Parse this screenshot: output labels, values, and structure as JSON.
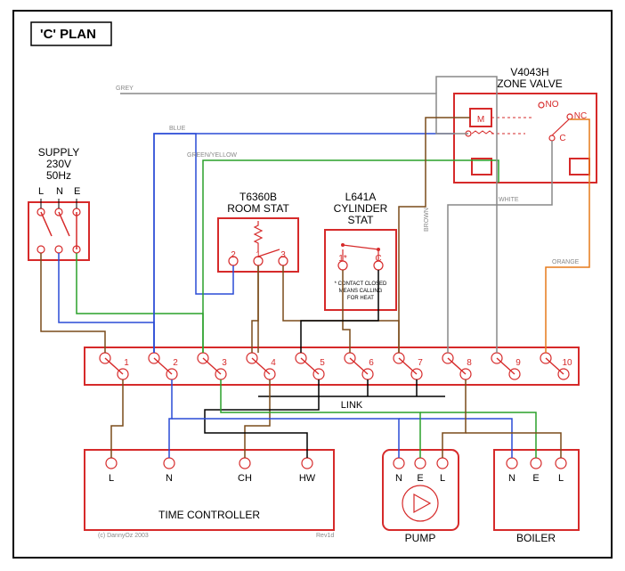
{
  "title": "'C' PLAN",
  "supply": {
    "label": "SUPPLY",
    "voltage": "230V",
    "hz": "50Hz",
    "terminals": [
      "L",
      "N",
      "E"
    ]
  },
  "room_stat": {
    "model": "T6360B",
    "label": "ROOM STAT",
    "terminals": [
      "2",
      "1",
      "3"
    ]
  },
  "cyl_stat": {
    "model": "L641A",
    "label": "CYLINDER",
    "label2": "STAT",
    "terminals": [
      "1*",
      "C"
    ],
    "note1": "* CONTACT CLOSED",
    "note2": "MEANS CALLING",
    "note3": "FOR HEAT"
  },
  "zone_valve": {
    "model": "V4043H",
    "label": "ZONE VALVE",
    "m": "M",
    "no": "NO",
    "nc": "NC",
    "c": "C"
  },
  "link_label": "LINK",
  "terminal_strip": [
    "1",
    "2",
    "3",
    "4",
    "5",
    "6",
    "7",
    "8",
    "9",
    "10"
  ],
  "time_controller": {
    "label": "TIME CONTROLLER",
    "terminals": [
      "L",
      "N",
      "CH",
      "HW"
    ]
  },
  "pump": {
    "label": "PUMP",
    "terminals": [
      "N",
      "E",
      "L"
    ]
  },
  "boiler": {
    "label": "BOILER",
    "terminals": [
      "N",
      "E",
      "L"
    ]
  },
  "wire_labels": {
    "grey": "GREY",
    "blue": "BLUE",
    "gy": "GREEN/YELLOW",
    "brown": "BROWN",
    "white": "WHITE",
    "orange": "ORANGE"
  },
  "rev": "Rev1d",
  "copyright": "(c) DannyOz 2003"
}
